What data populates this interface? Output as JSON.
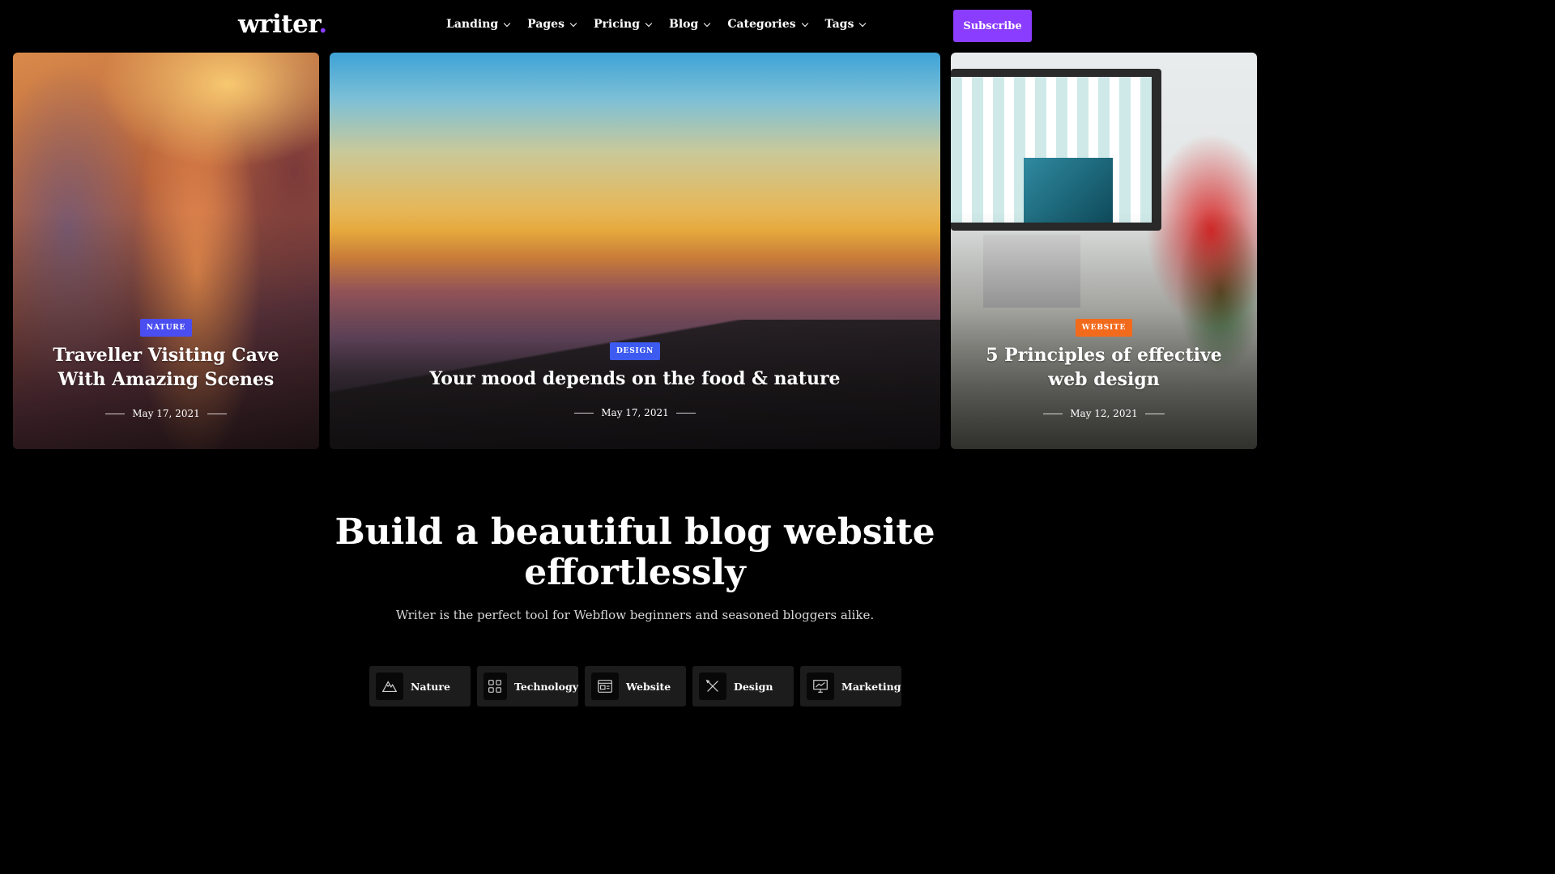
{
  "nav": {
    "logo": "writer",
    "logo_dot": ".",
    "menu": [
      {
        "label": "Landing"
      },
      {
        "label": "Pages"
      },
      {
        "label": "Pricing"
      },
      {
        "label": "Blog"
      },
      {
        "label": "Categories"
      },
      {
        "label": "Tags"
      }
    ],
    "subscribe_label": "Subscribe"
  },
  "featured": [
    {
      "badge": "NATURE",
      "badge_color": "#4a4df0",
      "title": "Traveller Visiting Cave With Amazing Scenes",
      "date": "May 17, 2021"
    },
    {
      "badge": "DESIGN",
      "badge_color": "#3d5bf0",
      "title": "Your mood depends on the food & nature",
      "date": "May 17, 2021"
    },
    {
      "badge": "WEBSITE",
      "badge_color": "#f26a1b",
      "title": "5 Principles of effective web design",
      "date": "May 12, 2021"
    }
  ],
  "hero": {
    "title_line1": "Build a beautiful blog website",
    "title_line2": "effortlessly",
    "subtitle": "Writer is the perfect tool for Webflow beginners and seasoned bloggers alike."
  },
  "categories": [
    {
      "label": "Nature",
      "icon": "mountain-icon"
    },
    {
      "label": "Technology",
      "icon": "grid-icon"
    },
    {
      "label": "Website",
      "icon": "browser-icon"
    },
    {
      "label": "Design",
      "icon": "pen-ruler-icon"
    },
    {
      "label": "Marketing",
      "icon": "presentation-icon"
    }
  ],
  "colors": {
    "accent": "#8b3dff",
    "background": "#000000",
    "chip_bg": "#1c1c1c"
  }
}
